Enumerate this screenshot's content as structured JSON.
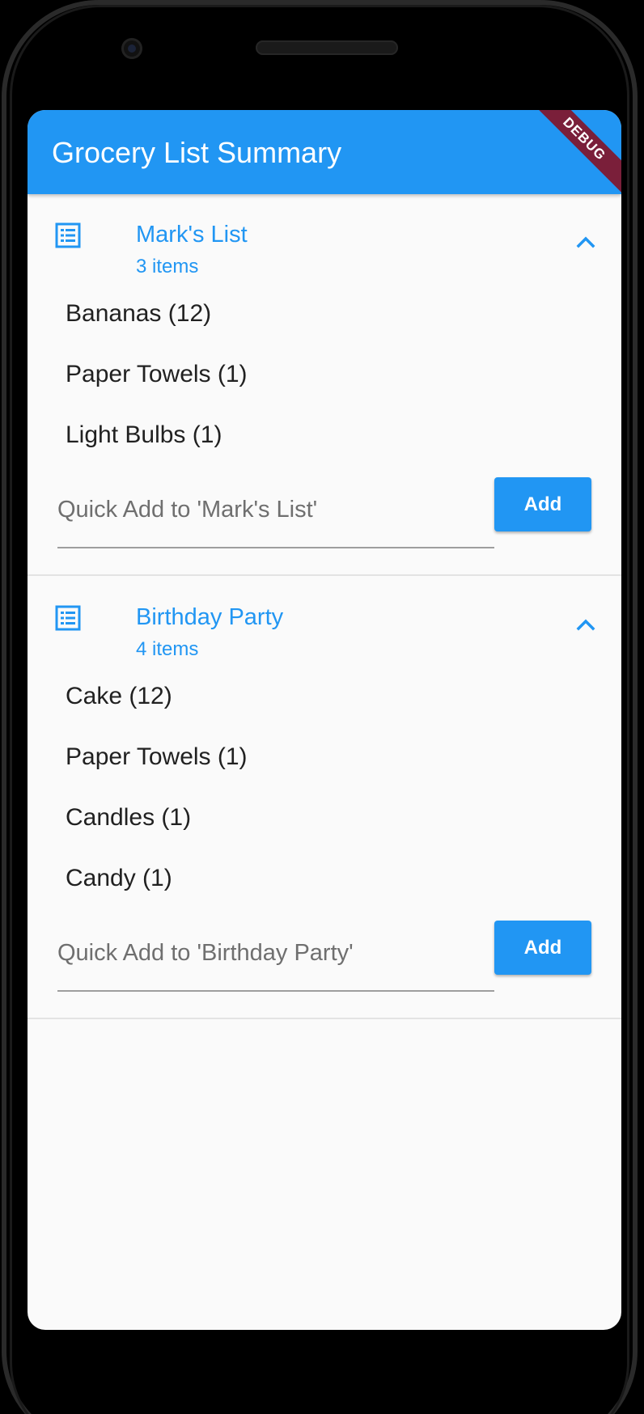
{
  "app": {
    "title": "Grocery List Summary",
    "debug_banner": "DEBUG",
    "accent_color": "#2196f3"
  },
  "lists": [
    {
      "name": "Mark's List",
      "count_label": "3 items",
      "icon": "list-icon",
      "expanded": true,
      "items": [
        {
          "label": "Bananas (12)"
        },
        {
          "label": "Paper Towels (1)"
        },
        {
          "label": "Light Bulbs (1)"
        }
      ],
      "quick_add_placeholder": "Quick Add to 'Mark's List'",
      "add_label": "Add"
    },
    {
      "name": "Birthday Party",
      "count_label": "4 items",
      "icon": "list-icon",
      "expanded": true,
      "items": [
        {
          "label": "Cake (12)"
        },
        {
          "label": "Paper Towels (1)"
        },
        {
          "label": "Candles (1)"
        },
        {
          "label": "Candy (1)"
        }
      ],
      "quick_add_placeholder": "Quick Add to 'Birthday Party'",
      "add_label": "Add"
    }
  ]
}
